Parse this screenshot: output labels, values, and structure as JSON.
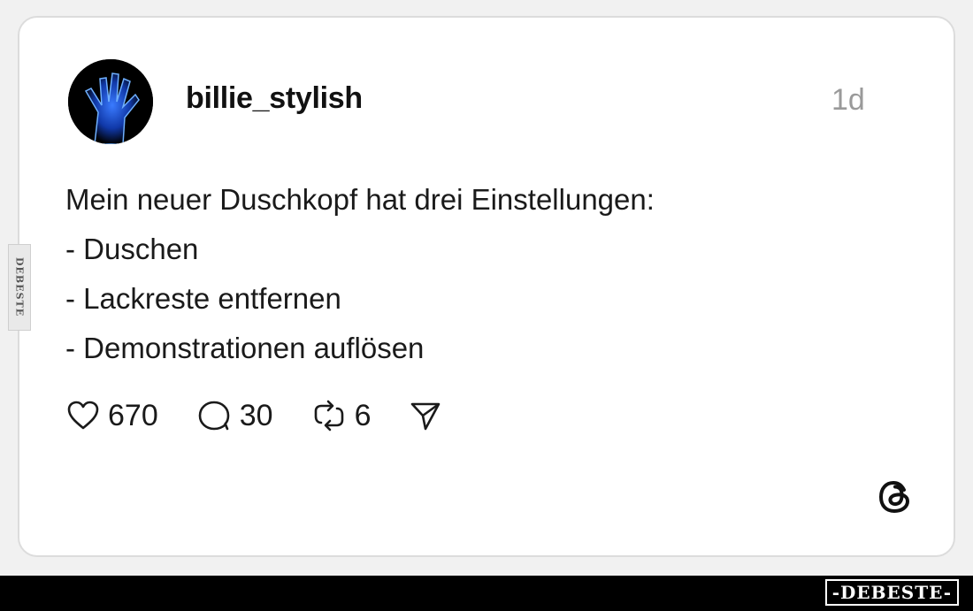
{
  "post": {
    "username": "billie_stylish",
    "time": "1d",
    "lines": [
      "Mein neuer Duschkopf hat drei Einstellungen:",
      "- Duschen",
      "- Lackreste entfernen",
      "- Demonstrationen auflösen"
    ]
  },
  "actions": {
    "likes": "670",
    "comments": "30",
    "reposts": "6",
    "icons": [
      "heart-icon",
      "comment-icon",
      "repost-icon",
      "share-icon"
    ]
  },
  "branding": {
    "platform_icon": "threads-logo-icon",
    "side_watermark": "DEBESTE",
    "footer_watermark": "-DEBESTE-"
  },
  "colors": {
    "card_background": "#ffffff",
    "text": "#1a1a1a",
    "muted": "#9a9a9a",
    "footer": "#000000"
  }
}
